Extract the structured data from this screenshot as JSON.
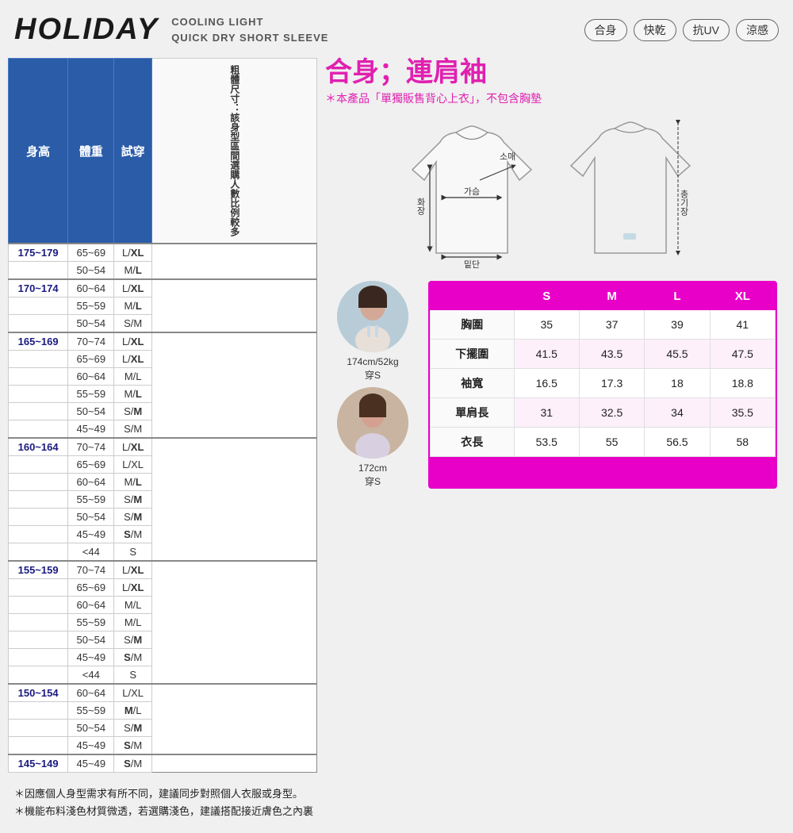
{
  "header": {
    "brand": "HOLIDAY",
    "subtitle_line1": "COOLING LIGHT",
    "subtitle_line2": "QUICK DRY SHORT SLEEVE",
    "tags": [
      "合身",
      "快乾",
      "抗UV",
      "涼感"
    ]
  },
  "fit_title": "合身；連肩袖",
  "fit_note": "＊本產品「單獨販售背心上衣」，不包含胸墊",
  "diagram_labels": {
    "화장": "화장",
    "가슴": "가슴",
    "소매": "소매",
    "밑단": "밑단",
    "총기장": "총기장"
  },
  "sizing_table": {
    "headers": [
      "身高",
      "體重",
      "試穿"
    ],
    "note_text": "粗體尺寸：該身型區間選購人數比例較多",
    "rows": [
      {
        "height": "175~179",
        "weight": "65~69",
        "size": "L/XL",
        "bold": "XL",
        "group_start": true
      },
      {
        "height": "",
        "weight": "50~54",
        "size": "M/L",
        "bold": "L"
      },
      {
        "height": "170~174",
        "weight": "60~64",
        "size": "L/XL",
        "bold": "XL",
        "group_start": true
      },
      {
        "height": "",
        "weight": "55~59",
        "size": "M/L",
        "bold": "L"
      },
      {
        "height": "",
        "weight": "50~54",
        "size": "S/M",
        "bold": ""
      },
      {
        "height": "165~169",
        "weight": "70~74",
        "size": "L/XL",
        "bold": "XL",
        "group_start": true
      },
      {
        "height": "",
        "weight": "65~69",
        "size": "L/XL",
        "bold": "XL"
      },
      {
        "height": "",
        "weight": "60~64",
        "size": "M/L",
        "bold": ""
      },
      {
        "height": "",
        "weight": "55~59",
        "size": "M/L",
        "bold": "L"
      },
      {
        "height": "",
        "weight": "50~54",
        "size": "S/M",
        "bold": "M"
      },
      {
        "height": "",
        "weight": "45~49",
        "size": "S/M",
        "bold": ""
      },
      {
        "height": "160~164",
        "weight": "70~74",
        "size": "L/XL",
        "bold": "XL",
        "group_start": true
      },
      {
        "height": "",
        "weight": "65~69",
        "size": "L/XL",
        "bold": ""
      },
      {
        "height": "",
        "weight": "60~64",
        "size": "M/L",
        "bold": "L"
      },
      {
        "height": "",
        "weight": "55~59",
        "size": "S/M",
        "bold": "M"
      },
      {
        "height": "",
        "weight": "50~54",
        "size": "S/M",
        "bold": "M"
      },
      {
        "height": "",
        "weight": "45~49",
        "size": "S/M",
        "bold": "S"
      },
      {
        "height": "",
        "weight": "<44",
        "size": "S",
        "bold": ""
      },
      {
        "height": "155~159",
        "weight": "70~74",
        "size": "L/XL",
        "bold": "XL",
        "group_start": true
      },
      {
        "height": "",
        "weight": "65~69",
        "size": "L/XL",
        "bold": "XL"
      },
      {
        "height": "",
        "weight": "60~64",
        "size": "M/L",
        "bold": ""
      },
      {
        "height": "",
        "weight": "55~59",
        "size": "M/L",
        "bold": ""
      },
      {
        "height": "",
        "weight": "50~54",
        "size": "S/M",
        "bold": "M"
      },
      {
        "height": "",
        "weight": "45~49",
        "size": "S/M",
        "bold": "S"
      },
      {
        "height": "",
        "weight": "<44",
        "size": "S",
        "bold": ""
      },
      {
        "height": "150~154",
        "weight": "60~64",
        "size": "L/XL",
        "bold": "",
        "group_start": true
      },
      {
        "height": "",
        "weight": "55~59",
        "size": "M/L",
        "bold": "M"
      },
      {
        "height": "",
        "weight": "50~54",
        "size": "S/M",
        "bold": "M"
      },
      {
        "height": "",
        "weight": "45~49",
        "size": "S/M",
        "bold": "S"
      },
      {
        "height": "145~149",
        "weight": "45~49",
        "size": "S/M",
        "bold": "S",
        "group_start": true
      }
    ]
  },
  "size_chart": {
    "sizes": [
      "S",
      "M",
      "L",
      "XL"
    ],
    "rows": [
      {
        "label": "胸圍",
        "values": [
          "35",
          "37",
          "39",
          "41"
        ]
      },
      {
        "label": "下擺圍",
        "values": [
          "41.5",
          "43.5",
          "45.5",
          "47.5"
        ]
      },
      {
        "label": "袖寬",
        "values": [
          "16.5",
          "17.3",
          "18",
          "18.8"
        ]
      },
      {
        "label": "單肩長",
        "values": [
          "31",
          "32.5",
          "34",
          "35.5"
        ]
      },
      {
        "label": "衣長",
        "values": [
          "53.5",
          "55",
          "56.5",
          "58"
        ]
      }
    ]
  },
  "model_1": {
    "label_line1": "174cm/52kg",
    "label_line2": "穿S"
  },
  "model_2": {
    "label_line1": "172cm",
    "label_line2": "穿S"
  },
  "footer": {
    "note1": "＊因應個人身型需求有所不同，建議同步對照個人衣服或身型。",
    "note2": "＊機能布料淺色材質微透，若選購淺色，建議搭配接近膚色之內裏"
  }
}
